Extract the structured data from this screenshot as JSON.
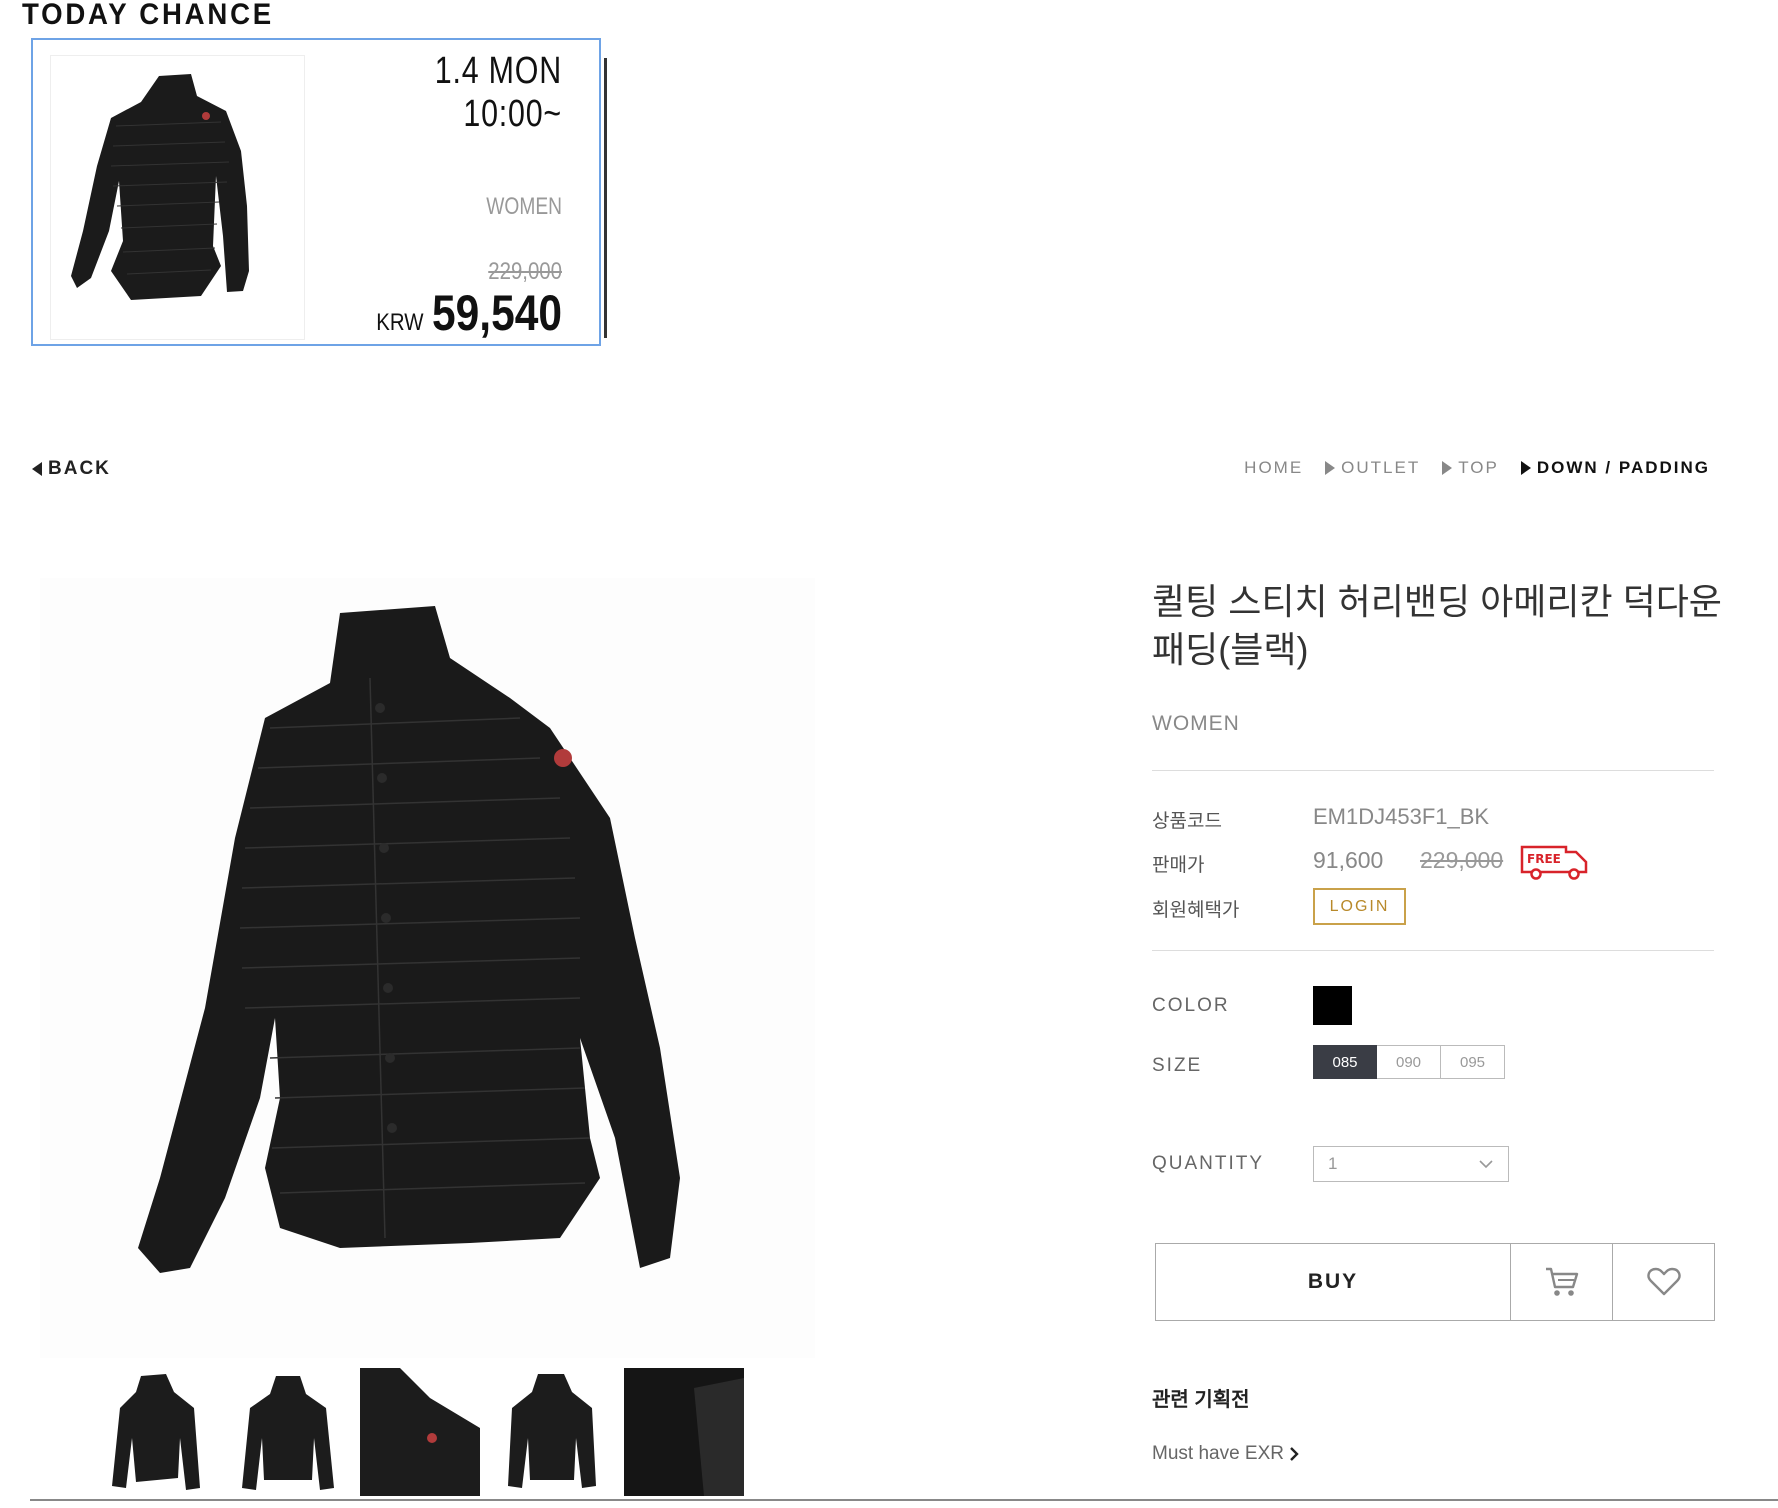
{
  "today_chance": {
    "title": "TODAY CHANCE",
    "date": "1.4 MON 10:00~",
    "category": "WOMEN",
    "original_price": "229,000",
    "currency": "KRW",
    "sale_price": "59,540"
  },
  "nav": {
    "back_label": "BACK",
    "breadcrumb": [
      "HOME",
      "OUTLET",
      "TOP",
      "DOWN / PADDING"
    ]
  },
  "product": {
    "title": "퀼팅 스티치 허리밴딩 아메리칸 덕다운 패딩(블랙)",
    "category": "WOMEN",
    "code_label": "상품코드",
    "code": "EM1DJ453F1_BK",
    "price_label": "판매가",
    "price": "91,600",
    "original_price": "229,000",
    "free_badge": "FREE",
    "member_label": "회원혜택가",
    "login_label": "LOGIN",
    "color_label": "COLOR",
    "color_value": "#000000",
    "size_label": "SIZE",
    "sizes": [
      "085",
      "090",
      "095"
    ],
    "selected_size": "085",
    "quantity_label": "QUANTITY",
    "quantity": "1",
    "buy_label": "BUY",
    "cart_icon": "cart-icon",
    "wish_icon": "heart-icon"
  },
  "related": {
    "title": "관련 기획전",
    "link": "Must have EXR"
  },
  "colors": {
    "accent_border": "#6ea3e6",
    "login_gold": "#c9a14a",
    "free_red": "#d8232a",
    "size_active": "#3a3d45"
  }
}
